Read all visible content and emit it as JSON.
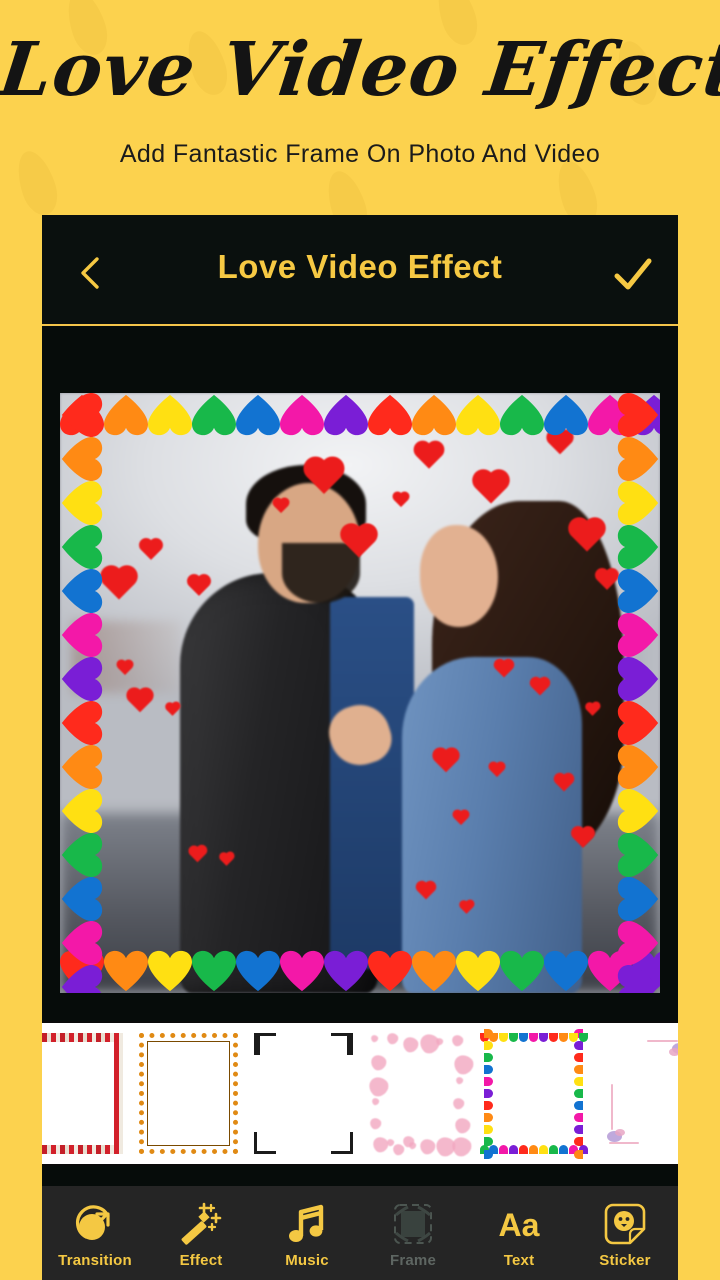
{
  "promo": {
    "title": "Love Video Effects",
    "subtitle": "Add Fantastic Frame On Photo And Video",
    "background_color": "#FCD24E"
  },
  "app": {
    "background_color": "#060C0A",
    "accent_color": "#F6C943",
    "appbar": {
      "back_icon": "chevron-left-icon",
      "title": "Love Video Effect",
      "done_icon": "check-icon"
    },
    "preview": {
      "name": "photo-preview",
      "frame_name": "rainbow-hearts-frame",
      "description": "Couple photo with red heart overlays inside a rainbow heart border",
      "overlay_heart_color": "#EC1C1C",
      "frame_colors": [
        "#FF2A1C",
        "#FF8A14",
        "#FFE012",
        "#18B84A",
        "#1273D1",
        "#F318A8",
        "#7A1ED6"
      ]
    },
    "frame_strip": {
      "name": "frame-thumbnail-strip",
      "selected_index": 4,
      "thumbnails": [
        {
          "name": "frame-thumb-roses",
          "style": "roses"
        },
        {
          "name": "frame-thumb-dotted",
          "style": "dotted"
        },
        {
          "name": "frame-thumb-corner",
          "style": "corner"
        },
        {
          "name": "frame-thumb-pink-hearts",
          "style": "pink-hearts"
        },
        {
          "name": "frame-thumb-rainbow-hearts",
          "style": "rainbow-hearts"
        },
        {
          "name": "frame-thumb-butterflies",
          "style": "butterflies"
        }
      ]
    },
    "toolbar": {
      "background_color": "#252525",
      "items": [
        {
          "label": "Transition",
          "icon": "transition-icon",
          "disabled": false
        },
        {
          "label": "Effect",
          "icon": "magic-wand-icon",
          "disabled": false
        },
        {
          "label": "Music",
          "icon": "music-note-icon",
          "disabled": false
        },
        {
          "label": "Frame",
          "icon": "frame-icon",
          "disabled": true
        },
        {
          "label": "Text",
          "icon": "text-aa-icon",
          "disabled": false
        },
        {
          "label": "Sticker",
          "icon": "sticker-icon",
          "disabled": false
        }
      ]
    }
  }
}
